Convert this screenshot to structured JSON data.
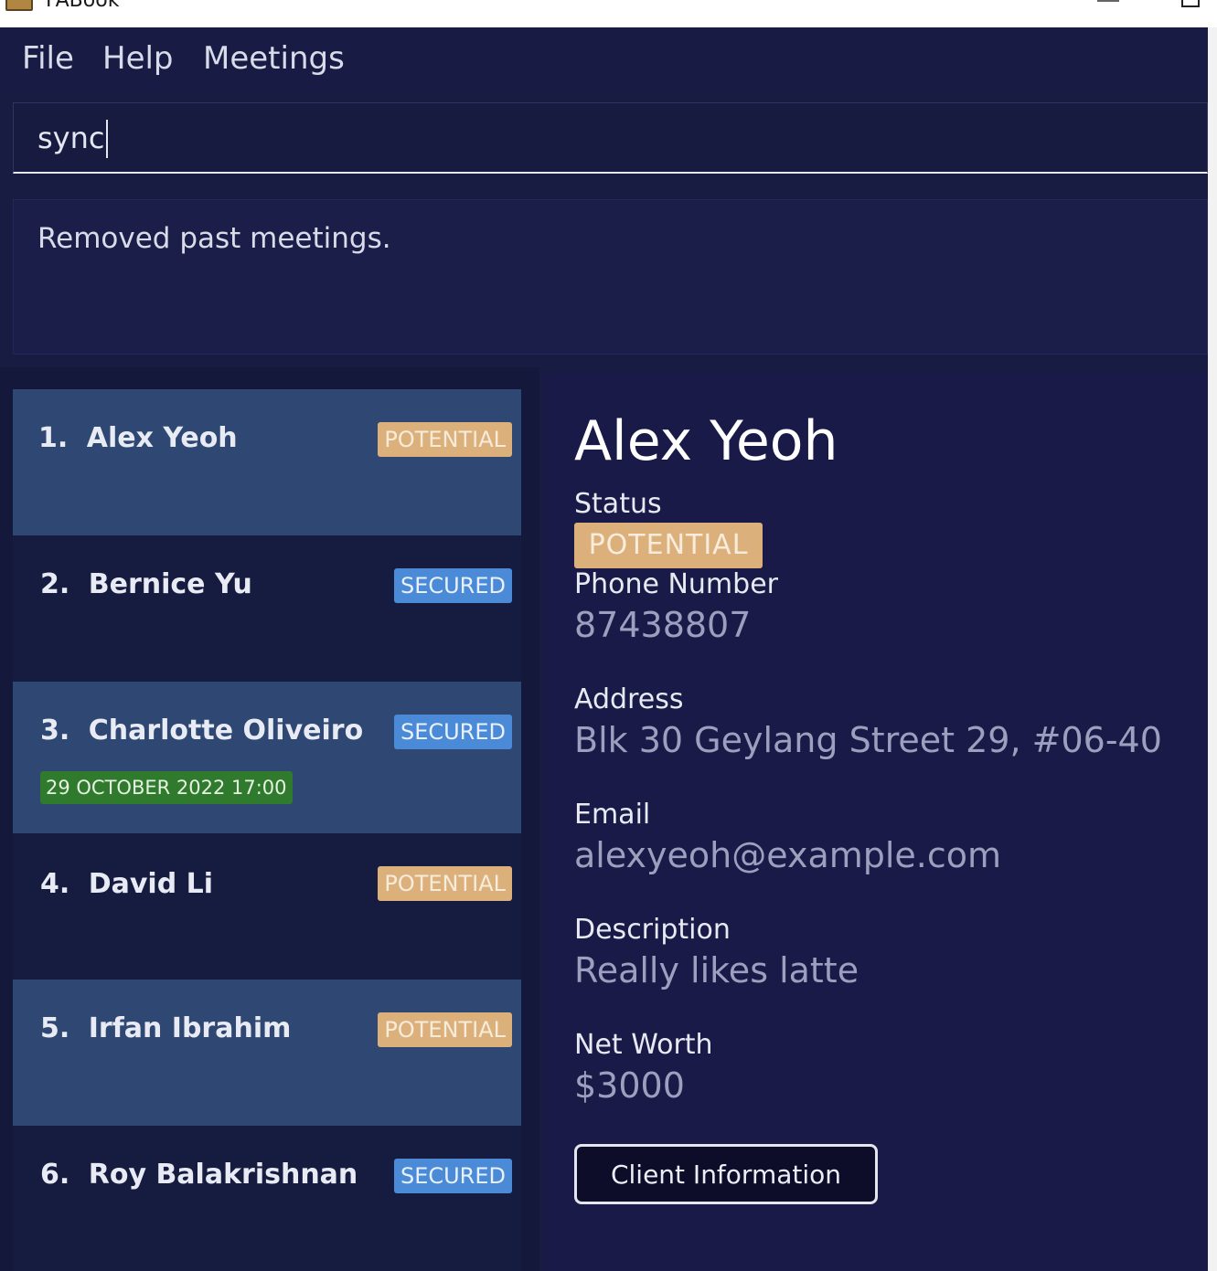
{
  "window": {
    "title": "FABook"
  },
  "menu": {
    "file": "File",
    "help": "Help",
    "meetings": "Meetings"
  },
  "command": {
    "value": "sync"
  },
  "result": {
    "message": "Removed past meetings."
  },
  "persons": [
    {
      "index": "1.",
      "name": "Alex Yeoh",
      "tag": "POTENTIAL",
      "meeting": ""
    },
    {
      "index": "2.",
      "name": "Bernice Yu",
      "tag": "SECURED",
      "meeting": ""
    },
    {
      "index": "3.",
      "name": "Charlotte Oliveiro",
      "tag": "SECURED",
      "meeting": "29 OCTOBER 2022 17:00"
    },
    {
      "index": "4.",
      "name": "David Li",
      "tag": "POTENTIAL",
      "meeting": ""
    },
    {
      "index": "5.",
      "name": "Irfan Ibrahim",
      "tag": "POTENTIAL",
      "meeting": ""
    },
    {
      "index": "6.",
      "name": "Roy Balakrishnan",
      "tag": "SECURED",
      "meeting": ""
    }
  ],
  "detail": {
    "name": "Alex Yeoh",
    "status_label": "Status",
    "status_value": "POTENTIAL",
    "phone_label": "Phone Number",
    "phone_value": "87438807",
    "address_label": "Address",
    "address_value": "Blk 30 Geylang Street 29, #06-40",
    "email_label": "Email",
    "email_value": "alexyeoh@example.com",
    "description_label": "Description",
    "description_value": "Really likes latte",
    "networth_label": "Net Worth",
    "networth_value": "$3000",
    "client_button": "Client Information"
  },
  "colors": {
    "background": "#181b42",
    "card_highlight": "#2e4873",
    "tag_potential": "#dcb07a",
    "tag_secured": "#4a8ad6",
    "tag_meeting": "#2f7a2c"
  }
}
